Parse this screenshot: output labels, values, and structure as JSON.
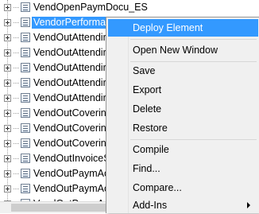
{
  "tree": {
    "items": [
      "VendOpenPaymDocu_ES",
      "VendorPerformance",
      "VendOutAttending",
      "VendOutAttending",
      "VendOutAttending",
      "VendOutAttending",
      "VendOutAttending",
      "VendOutCovering",
      "VendOutCovering",
      "VendOutCovering",
      "VendOutInvoiceS",
      "VendOutPaymAc",
      "VendOutPaymAc",
      "VendOutPaymAc"
    ],
    "visible_labels": [
      "VendOpenPaymDocu_ES",
      "VendorPerforma",
      "VendOutAttendir",
      "VendOutAttendir",
      "VendOutAttendir",
      "VendOutAttendir",
      "VendOutAttendir",
      "VendOutCoverin",
      "VendOutCoverin",
      "VendOutCoverin",
      "VendOutInvoiceS",
      "VendOutPaymAc",
      "VendOutPaymAc",
      "VendOutPaymAc"
    ],
    "selected_index": 1
  },
  "context_menu": {
    "deploy_element": "Deploy Element",
    "open_new_window": "Open New Window",
    "save": "Save",
    "export": "Export",
    "delete": "Delete",
    "restore": "Restore",
    "compile": "Compile",
    "find": "Find...",
    "compare": "Compare...",
    "add_ins": "Add-Ins"
  },
  "colors": {
    "highlight": "#3399ff",
    "menu_background": "#f0f0f0"
  }
}
